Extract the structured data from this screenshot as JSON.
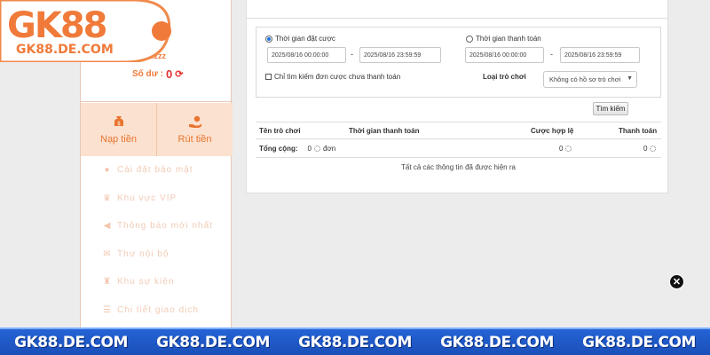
{
  "logo": {
    "brand": "GK88",
    "domain": "GK88.DE.COM"
  },
  "user": {
    "username": "gk88zzz",
    "balance_label": "Số dư :",
    "balance_value": "0"
  },
  "actions": [
    {
      "label": "Nạp tiền",
      "icon": "money-bag-icon"
    },
    {
      "label": "Rút tiền",
      "icon": "hand-money-icon"
    }
  ],
  "menu": [
    {
      "label": "Cài đặt bảo mật",
      "icon": "user-lock-icon"
    },
    {
      "label": "Khu vực VIP",
      "icon": "crown-icon"
    },
    {
      "label": "Thông báo mới nhất",
      "icon": "megaphone-icon"
    },
    {
      "label": "Thư nội bộ",
      "icon": "mail-icon"
    },
    {
      "label": "Khu sự kiện",
      "icon": "trophy-icon"
    },
    {
      "label": "Chi tiết giao dịch",
      "icon": "list-icon"
    }
  ],
  "filter": {
    "bet_time_label": "Thời gian đặt cược",
    "pay_time_label": "Thời gian thanh toán",
    "bet_from": "2025/08/16 00:00:00",
    "bet_to": "2025/08/16 23:59:59",
    "pay_from": "2025/08/16 00:00:00",
    "pay_to": "2025/08/16 23:59:59",
    "separator": "-",
    "unpaid_only_label": "Chỉ tìm kiếm đơn cược chưa thanh toán",
    "game_type_label": "Loại trò chơi",
    "game_type_value": "Không có hồ sơ trò chơi",
    "search_button": "Tìm kiếm"
  },
  "table": {
    "headers": [
      "Tên trò chơi",
      "Thời gian thanh toán",
      "Cược hợp lệ",
      "Thanh toán"
    ],
    "total_label": "Tổng cộng:",
    "total_count": "0",
    "total_unit": "đơn",
    "valid_bet_total": "0",
    "payout_total": "0",
    "footer_note": "Tất cả các thông tin đã được hiện ra"
  },
  "banner": {
    "items": [
      "GK88.DE.COM",
      "GK88.DE.COM",
      "GK88.DE.COM",
      "GK88.DE.COM",
      "GK88.DE.COM"
    ]
  },
  "colors": {
    "accent": "#f07a3a",
    "banner": "#2563d6",
    "balance": "#e5312f"
  }
}
